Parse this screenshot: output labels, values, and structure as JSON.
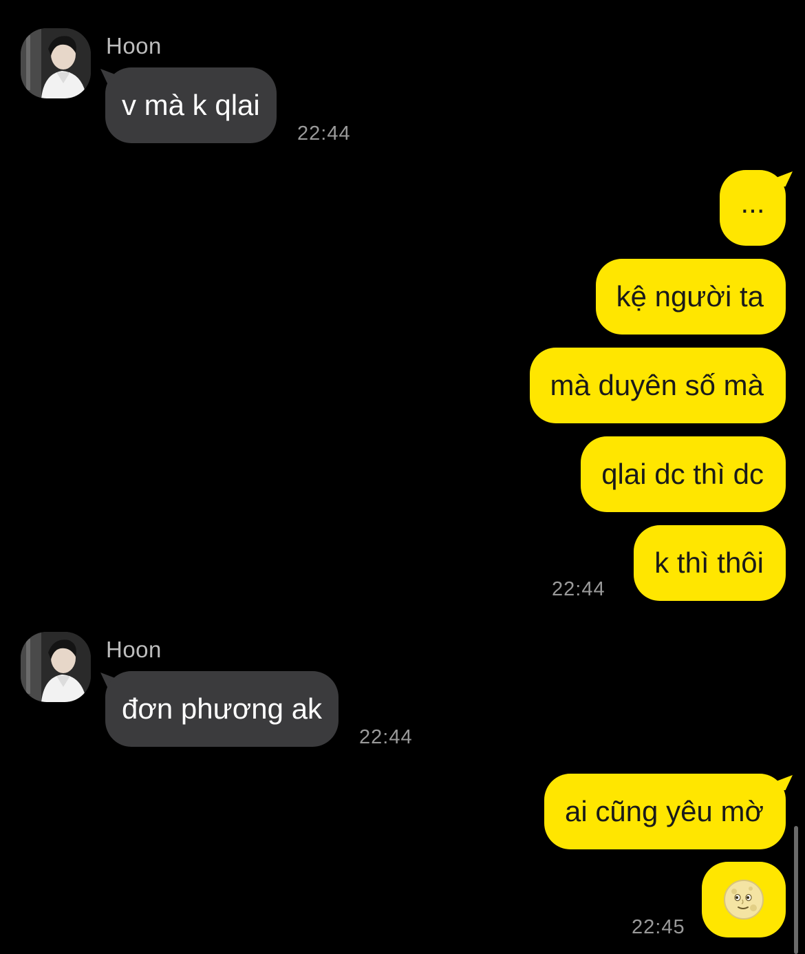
{
  "contact": {
    "name": "Hoon"
  },
  "colors": {
    "background": "#000000",
    "incoming_bubble": "#3b3b3d",
    "outgoing_bubble": "#ffe600",
    "timestamp": "#9a9a9a"
  },
  "messages": [
    {
      "direction": "incoming",
      "sender": "Hoon",
      "text": "v mà k qlai",
      "time": "22:44"
    },
    {
      "direction": "outgoing",
      "text": "...",
      "time": ""
    },
    {
      "direction": "outgoing",
      "text": "kệ người ta",
      "time": ""
    },
    {
      "direction": "outgoing",
      "text": "mà duyên số mà",
      "time": ""
    },
    {
      "direction": "outgoing",
      "text": "qlai dc thì dc",
      "time": ""
    },
    {
      "direction": "outgoing",
      "text": "k thì thôi",
      "time": "22:44"
    },
    {
      "direction": "incoming",
      "sender": "Hoon",
      "text": "đơn phương ak",
      "time": "22:44"
    },
    {
      "direction": "outgoing",
      "text": "ai cũng yêu mờ",
      "time": ""
    },
    {
      "direction": "outgoing",
      "text": "",
      "emoji": "full-moon-face-icon",
      "time": "22:45"
    }
  ]
}
